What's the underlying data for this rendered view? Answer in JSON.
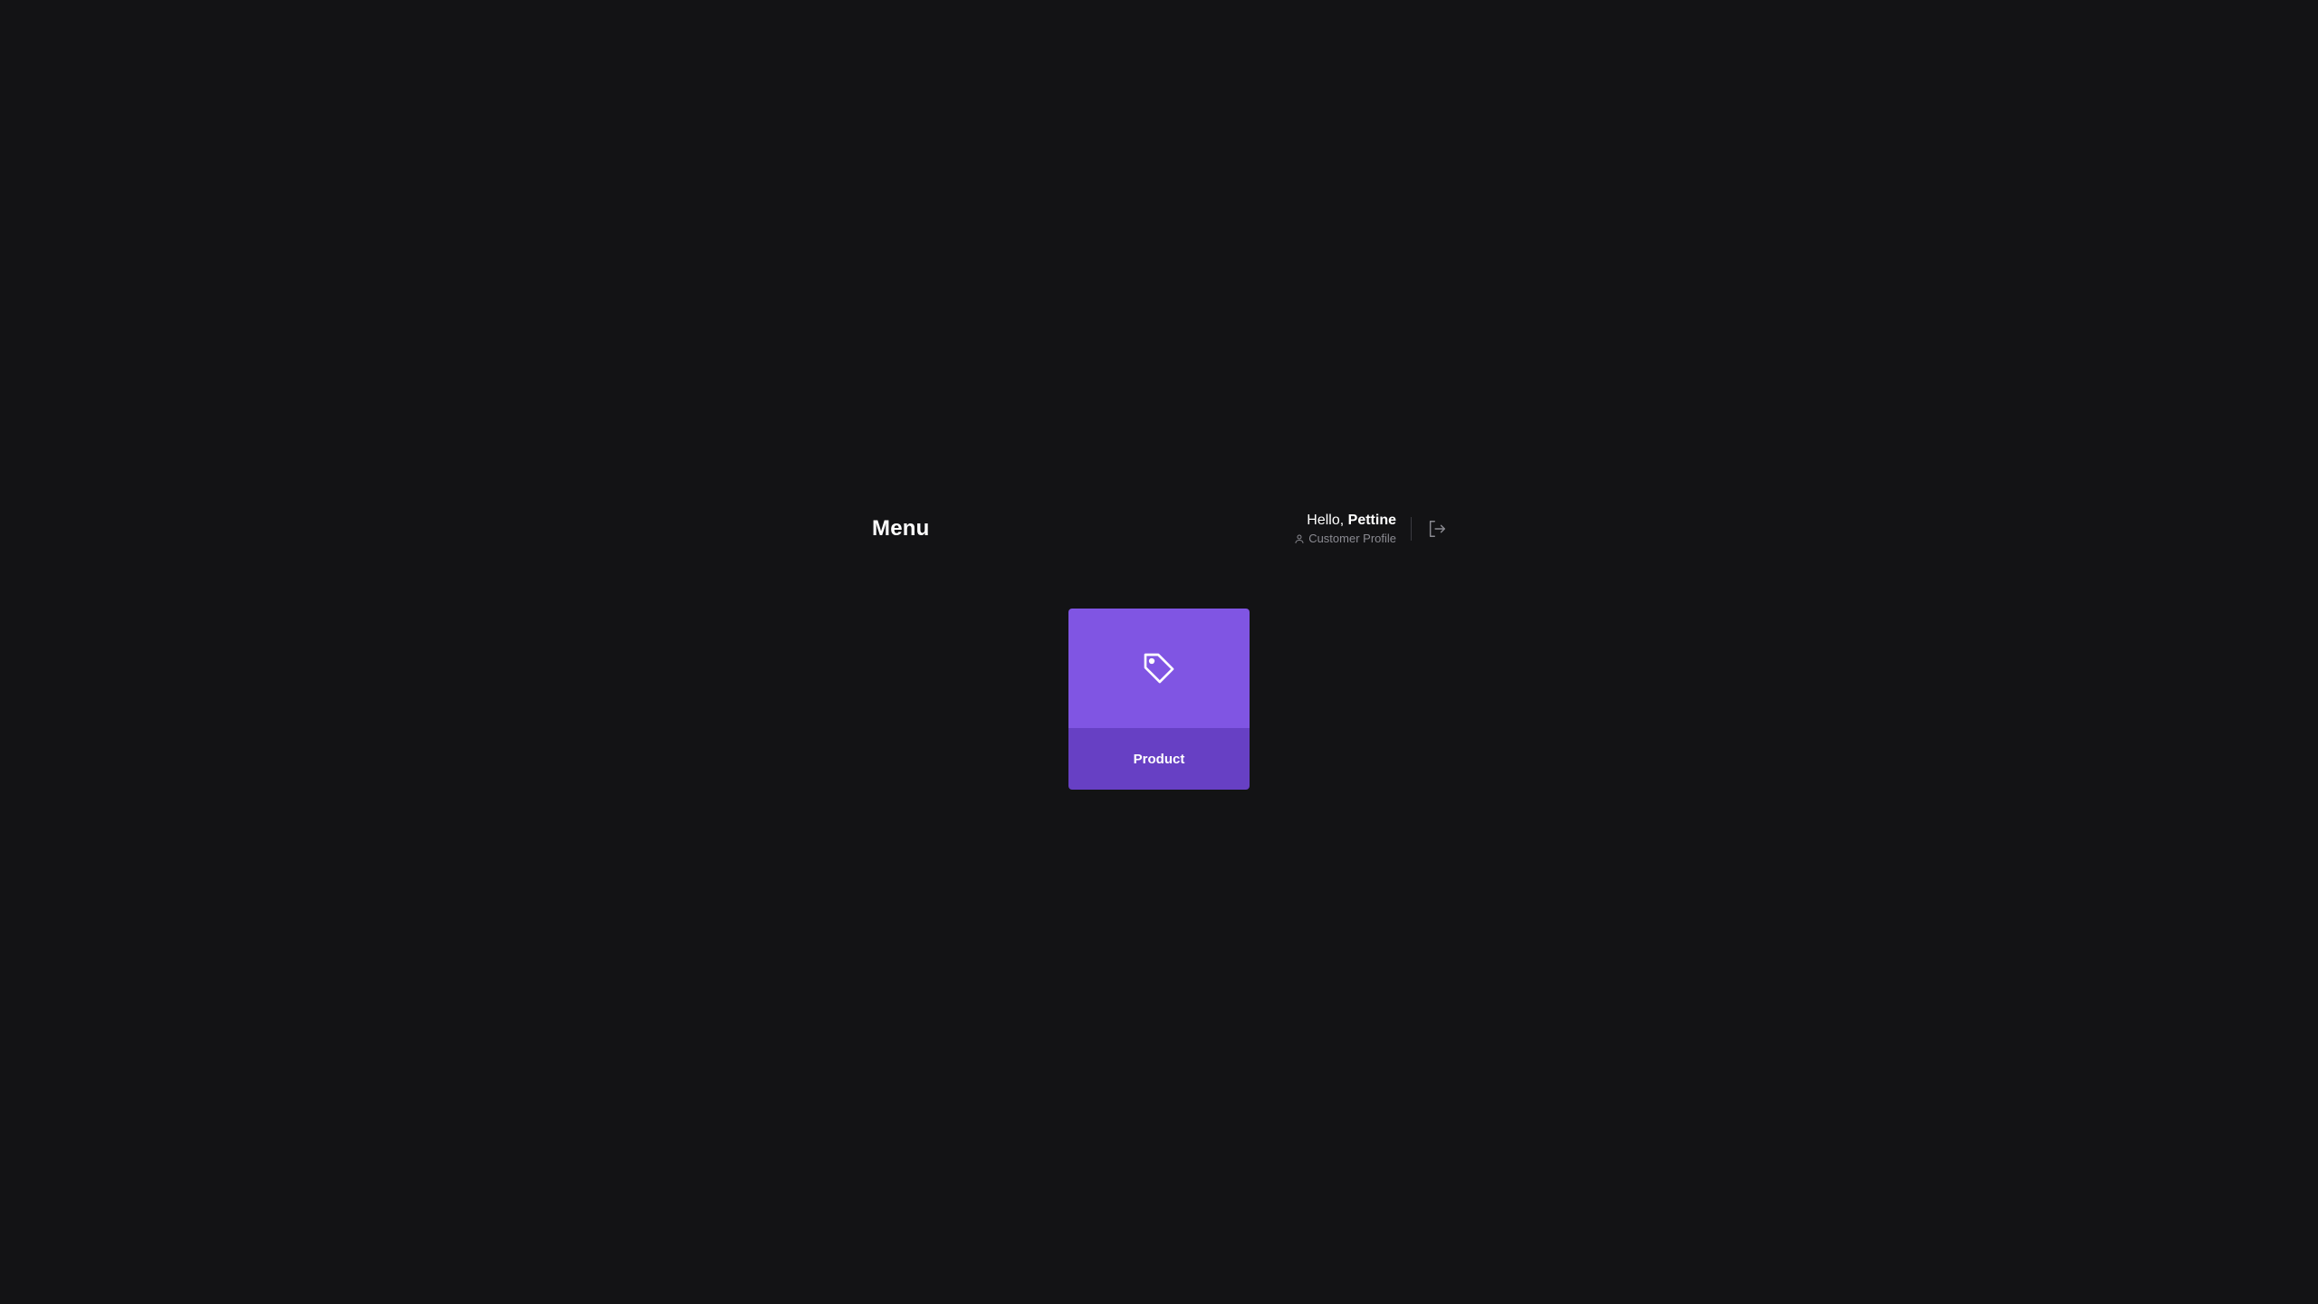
{
  "header": {
    "title": "Menu",
    "greeting_prefix": "Hello, ",
    "user_name": "Pettine",
    "profile_label": "Customer Profile"
  },
  "menu_items": [
    {
      "label": "Product",
      "icon": "tag-icon"
    }
  ],
  "colors": {
    "background": "#131315",
    "tile_top": "#8055e3",
    "tile_bottom": "#6740c4",
    "muted_text": "#8a8a91"
  }
}
